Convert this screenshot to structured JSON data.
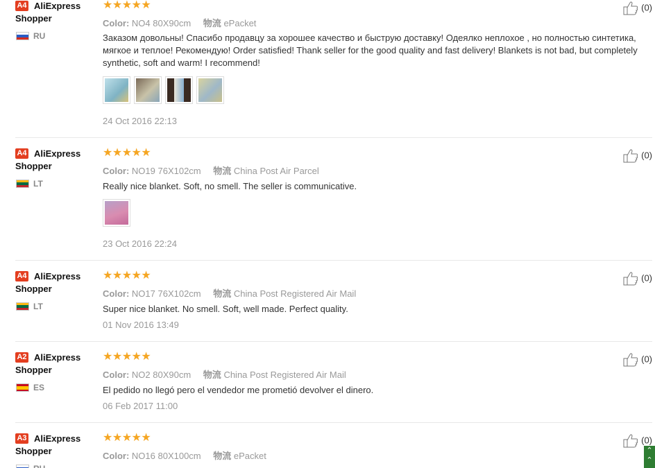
{
  "reviews": [
    {
      "badge": "A4",
      "user": "AliExpress Shopper",
      "country": "RU",
      "stars": "★★★★★",
      "color_label": "Color:",
      "color_value": "NO4 80X90cm",
      "ship_label": "物流",
      "ship_value": "ePacket",
      "text": "Заказом довольны! Спасибо продавцу за хорошее качество и быструю доставку! Одеялко неплохое , но полностью синтетика, мягкое и теплое! Рекомендую! Order satisfied! Thank seller for the good quality and fast delivery! Blankets is not bad, but completely synthetic, soft and warm! I recommend!",
      "photos": [
        "#9ccbd8",
        "#a89a7e",
        "#6c8fb5",
        "#b9b47c"
      ],
      "date": "24 Oct 2016 22:13",
      "likes": "(0)"
    },
    {
      "badge": "A4",
      "user": "AliExpress Shopper",
      "country": "LT",
      "stars": "★★★★★",
      "color_label": "Color:",
      "color_value": "NO19 76X102cm",
      "ship_label": "物流",
      "ship_value": "China Post Air Parcel",
      "text": "Really nice blanket. Soft, no smell. The seller is communicative.",
      "photos": [
        "#c97fa8"
      ],
      "date": "23 Oct 2016 22:24",
      "likes": "(0)"
    },
    {
      "badge": "A4",
      "user": "AliExpress Shopper",
      "country": "LT",
      "stars": "★★★★★",
      "color_label": "Color:",
      "color_value": "NO17 76X102cm",
      "ship_label": "物流",
      "ship_value": "China Post Registered Air Mail",
      "text": "Super nice blanket. No smell. Soft, well made. Perfect quality.",
      "photos": [],
      "date": "01 Nov 2016 13:49",
      "likes": "(0)"
    },
    {
      "badge": "A2",
      "user": "AliExpress Shopper",
      "country": "ES",
      "stars": "★★★★★",
      "color_label": "Color:",
      "color_value": "NO2 80X90cm",
      "ship_label": "物流",
      "ship_value": "China Post Registered Air Mail",
      "text": "El pedido no llegó pero el vendedor me prometió devolver el dinero.",
      "photos": [],
      "date": "06 Feb 2017 11:00",
      "likes": "(0)"
    },
    {
      "badge": "A3",
      "user": "AliExpress Shopper",
      "country": "RU",
      "stars": "★★★★★",
      "color_label": "Color:",
      "color_value": "NO16 80X100cm",
      "ship_label": "物流",
      "ship_value": "ePacket",
      "text": "",
      "photos": [],
      "date": "",
      "likes": "(0)"
    }
  ],
  "colors": {
    "accent_badge": "#e33e20",
    "star": "#f5a623",
    "scroll_button": "#2e7d32"
  },
  "icons": {
    "like": "thumbs-up-icon",
    "scroll": "back-to-top-icon"
  }
}
